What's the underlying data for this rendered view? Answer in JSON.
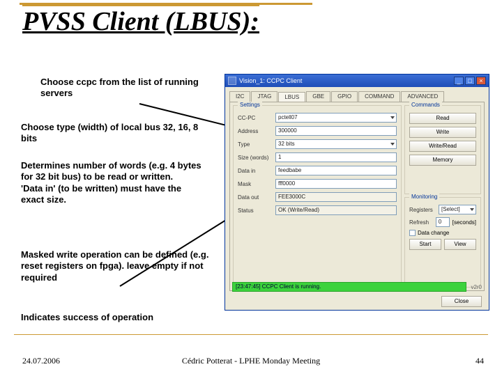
{
  "title": "PVSS Client (LBUS):",
  "bullets": {
    "b1": "Choose ccpc from the list of running servers",
    "b2": "Choose type (width) of local bus 32, 16, 8 bits",
    "b3": "Determines number of words (e.g. 4 bytes for 32 bit bus) to be read or written.\n'Data in' (to be written) must have the exact size.",
    "b4": "Masked write operation can be defined (e.g. reset registers on fpga). leave empty if not required",
    "b5": "Indicates success of operation"
  },
  "window": {
    "title": "Vision_1: CCPC Client",
    "tabs": [
      "I2C",
      "JTAG",
      "LBUS",
      "GBE",
      "GPIO",
      "COMMAND",
      "ADVANCED"
    ],
    "active_tab": "LBUS",
    "settings_legend": "Settings",
    "commands_legend": "Commands",
    "monitoring_legend": "Monitoring",
    "fields": {
      "ccpc_label": "CC-PC",
      "ccpc": "pctell07",
      "addr_label": "Address",
      "addr": "300000",
      "type_label": "Type",
      "type": "32 bits",
      "size_label": "Size (words)",
      "size": "1",
      "datain_label": "Data in",
      "datain": "feedbabe",
      "mask_label": "Mask",
      "mask": "fff0000",
      "dataout_label": "Data out",
      "dataout": "FEE3000C",
      "status_label": "Status",
      "status": "OK (Write/Read)"
    },
    "commands": {
      "read": "Read",
      "write": "Write",
      "writeread": "Write/Read",
      "memory": "Memory"
    },
    "monitoring": {
      "registers_label": "Registers",
      "registers": "[Select]",
      "refresh_label": "Refresh",
      "refresh_value": "0",
      "refresh_unit": "[seconds]",
      "datachange": "Data change",
      "start": "Start",
      "view": "View"
    },
    "statusbar": "[23:47:45] CCPC Client is running.",
    "version": "v2r0",
    "close": "Close"
  },
  "footer": {
    "date": "24.07.2006",
    "center": "Cédric Potterat - LPHE Monday Meeting",
    "page": "44"
  }
}
